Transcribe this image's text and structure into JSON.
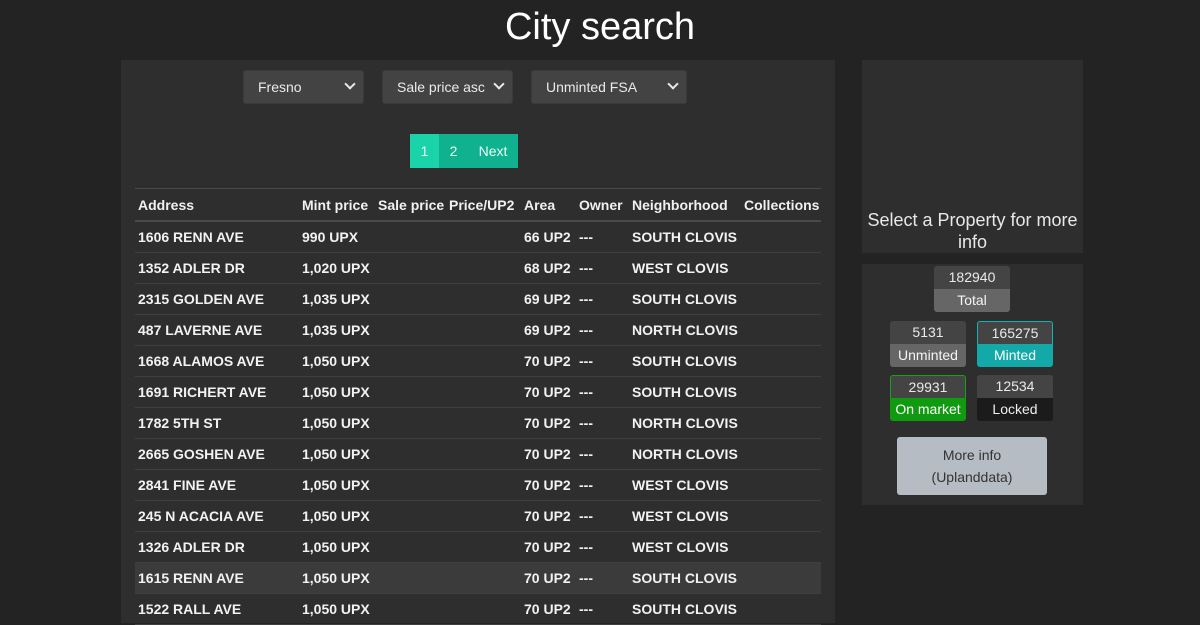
{
  "page": {
    "title": "City search"
  },
  "filters": {
    "city": "Fresno",
    "sort": "Sale price asc",
    "status": "Unminted FSA"
  },
  "pagination": {
    "page1": "1",
    "page2": "2",
    "next": "Next"
  },
  "table": {
    "headers": [
      "Address",
      "Mint price",
      "Sale price",
      "Price/UP2",
      "Area",
      "Owner",
      "Neighborhood",
      "Collections"
    ],
    "rows": [
      [
        "1606 RENN AVE",
        "990 UPX",
        "",
        "",
        "66 UP2",
        "---",
        "SOUTH CLOVIS",
        ""
      ],
      [
        "1352 ADLER DR",
        "1,020 UPX",
        "",
        "",
        "68 UP2",
        "---",
        "WEST CLOVIS",
        ""
      ],
      [
        "2315 GOLDEN AVE",
        "1,035 UPX",
        "",
        "",
        "69 UP2",
        "---",
        "SOUTH CLOVIS",
        ""
      ],
      [
        "487 LAVERNE AVE",
        "1,035 UPX",
        "",
        "",
        "69 UP2",
        "---",
        "NORTH CLOVIS",
        ""
      ],
      [
        "1668 ALAMOS AVE",
        "1,050 UPX",
        "",
        "",
        "70 UP2",
        "---",
        "SOUTH CLOVIS",
        ""
      ],
      [
        "1691 RICHERT AVE",
        "1,050 UPX",
        "",
        "",
        "70 UP2",
        "---",
        "SOUTH CLOVIS",
        ""
      ],
      [
        "1782 5TH ST",
        "1,050 UPX",
        "",
        "",
        "70 UP2",
        "---",
        "NORTH CLOVIS",
        ""
      ],
      [
        "2665 GOSHEN AVE",
        "1,050 UPX",
        "",
        "",
        "70 UP2",
        "---",
        "NORTH CLOVIS",
        ""
      ],
      [
        "2841 FINE AVE",
        "1,050 UPX",
        "",
        "",
        "70 UP2",
        "---",
        "WEST CLOVIS",
        ""
      ],
      [
        "245 N ACACIA AVE",
        "1,050 UPX",
        "",
        "",
        "70 UP2",
        "---",
        "WEST CLOVIS",
        ""
      ],
      [
        "1326 ADLER DR",
        "1,050 UPX",
        "",
        "",
        "70 UP2",
        "---",
        "WEST CLOVIS",
        ""
      ],
      [
        "1615 RENN AVE",
        "1,050 UPX",
        "",
        "",
        "70 UP2",
        "---",
        "SOUTH CLOVIS",
        ""
      ],
      [
        "1522 RALL AVE",
        "1,050 UPX",
        "",
        "",
        "70 UP2",
        "---",
        "SOUTH CLOVIS",
        ""
      ]
    ]
  },
  "sidebar": {
    "message": "Select a Property for more info",
    "stats": {
      "total": {
        "value": "182940",
        "label": "Total"
      },
      "unminted": {
        "value": "5131",
        "label": "Unminted"
      },
      "minted": {
        "value": "165275",
        "label": "Minted"
      },
      "on_market": {
        "value": "29931",
        "label": "On market"
      },
      "locked": {
        "value": "12534",
        "label": "Locked"
      }
    },
    "more_info_line1": "More info",
    "more_info_line2": "(Uplanddata)"
  },
  "colors": {
    "accent": "#1bd3a8",
    "minted": "#14a9a9",
    "on_market": "#0f9a0f",
    "background": "#232323"
  }
}
